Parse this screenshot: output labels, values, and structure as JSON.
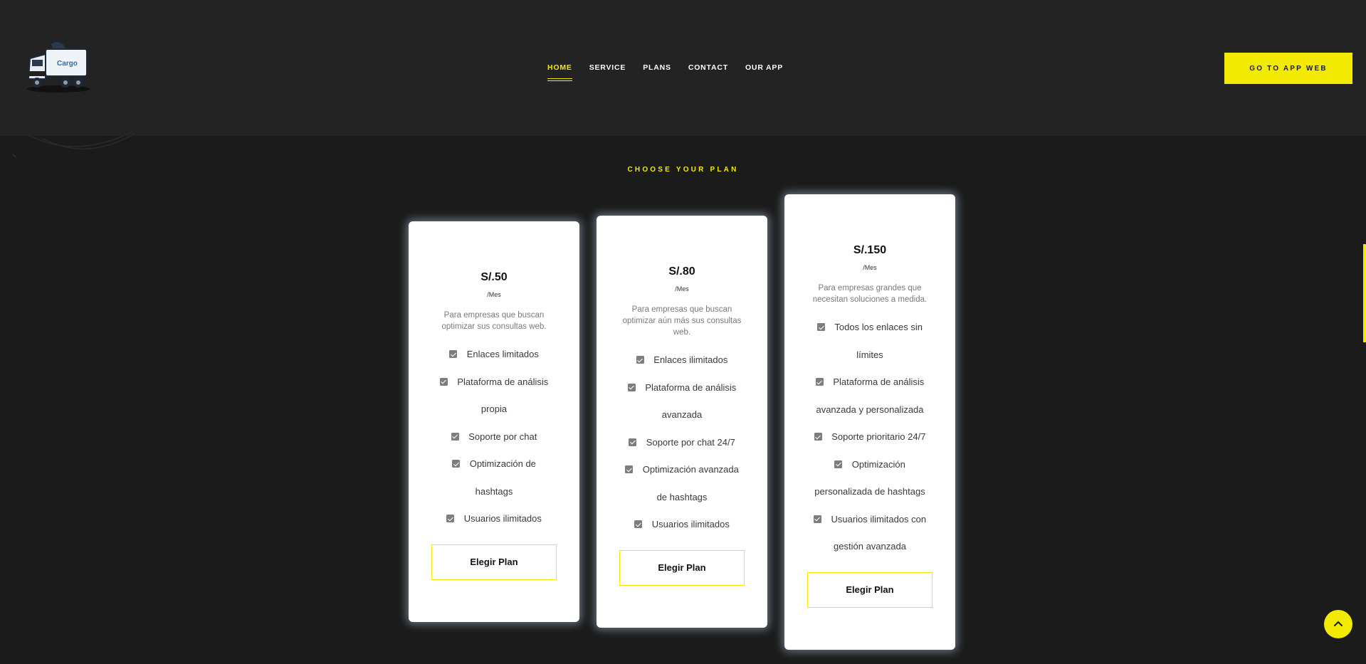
{
  "header": {
    "logo_name": "truck-logo",
    "nav": [
      {
        "label": "HOME",
        "active": true
      },
      {
        "label": "SERVICE",
        "active": false
      },
      {
        "label": "PLANS",
        "active": false
      },
      {
        "label": "CONTACT",
        "active": false
      },
      {
        "label": "OUR APP",
        "active": false
      }
    ],
    "cta_label": "GO TO APP WEB"
  },
  "plans_section": {
    "title": "CHOOSE YOUR PLAN",
    "plans": [
      {
        "price": "S/.50",
        "period": "/Mes",
        "description": "Para empresas que buscan optimizar sus consultas web.",
        "features": [
          "Enlaces limitados",
          "Plataforma de análisis propia",
          "Soporte por chat",
          "Optimización de hashtags",
          "Usuarios ilimitados"
        ],
        "button_label": "Elegir Plan"
      },
      {
        "price": "S/.80",
        "period": "/Mes",
        "description": "Para empresas que buscan optimizar aún más sus consultas web.",
        "features": [
          "Enlaces ilimitados",
          "Plataforma de análisis avanzada",
          "Soporte por chat 24/7",
          "Optimización avanzada de hashtags",
          "Usuarios ilimitados"
        ],
        "button_label": "Elegir Plan"
      },
      {
        "price": "S/.150",
        "period": "/Mes",
        "description": "Para empresas grandes que necesitan soluciones a medida.",
        "features": [
          "Todos los enlaces sin límites",
          "Plataforma de análisis avanzada y personalizada",
          "Soporte prioritario 24/7",
          "Optimización personalizada de hashtags",
          "Usuarios ilimitados con gestión avanzada"
        ],
        "button_label": "Elegir Plan"
      }
    ]
  },
  "colors": {
    "accent": "#f2ea00",
    "header_bg": "#232323",
    "page_bg": "#1b1b1b",
    "card_bg": "#ffffff"
  },
  "icons": {
    "check": "check-square-icon",
    "back_to_top": "chevron-up-icon"
  }
}
